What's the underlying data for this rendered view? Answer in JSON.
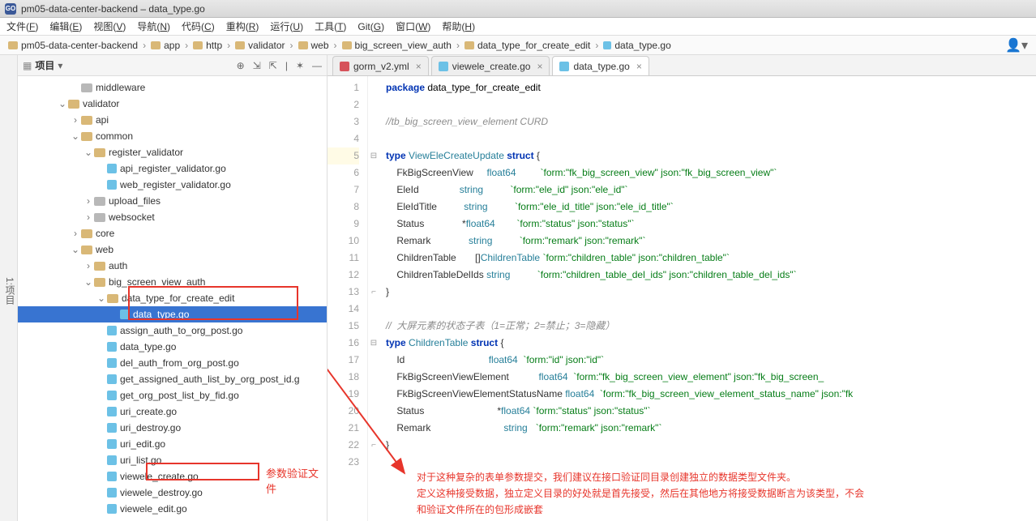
{
  "window": {
    "title": "pm05-data-center-backend – data_type.go",
    "app_icon": "GO"
  },
  "menubar": [
    {
      "l": "文件",
      "u": "F"
    },
    {
      "l": "编辑",
      "u": "E"
    },
    {
      "l": "视图",
      "u": "V"
    },
    {
      "l": "导航",
      "u": "N"
    },
    {
      "l": "代码",
      "u": "C"
    },
    {
      "l": "重构",
      "u": "R"
    },
    {
      "l": "运行",
      "u": "U"
    },
    {
      "l": "工具",
      "u": "T"
    },
    {
      "l": "Git",
      "u": "G"
    },
    {
      "l": "窗口",
      "u": "W"
    },
    {
      "l": "帮助",
      "u": "H"
    }
  ],
  "breadcrumbs": [
    "pm05-data-center-backend",
    "app",
    "http",
    "validator",
    "web",
    "big_screen_view_auth",
    "data_type_for_create_edit",
    "data_type.go"
  ],
  "sidebar": {
    "title": "项目",
    "left_gutter_label": "1:项目",
    "tree": [
      {
        "depth": 4,
        "tw": "",
        "icon": "dirgrey",
        "label": "middleware"
      },
      {
        "depth": 3,
        "tw": "v",
        "icon": "dir",
        "label": "validator"
      },
      {
        "depth": 4,
        "tw": ">",
        "icon": "dir",
        "label": "api"
      },
      {
        "depth": 4,
        "tw": "v",
        "icon": "dir",
        "label": "common"
      },
      {
        "depth": 5,
        "tw": "v",
        "icon": "dir",
        "label": "register_validator"
      },
      {
        "depth": 6,
        "tw": "",
        "icon": "go",
        "label": "api_register_validator.go"
      },
      {
        "depth": 6,
        "tw": "",
        "icon": "go",
        "label": "web_register_validator.go"
      },
      {
        "depth": 5,
        "tw": ">",
        "icon": "dirgrey",
        "label": "upload_files"
      },
      {
        "depth": 5,
        "tw": ">",
        "icon": "dirgrey",
        "label": "websocket"
      },
      {
        "depth": 4,
        "tw": ">",
        "icon": "dir",
        "label": "core"
      },
      {
        "depth": 4,
        "tw": "v",
        "icon": "dir",
        "label": "web"
      },
      {
        "depth": 5,
        "tw": ">",
        "icon": "dir",
        "label": "auth"
      },
      {
        "depth": 5,
        "tw": "v",
        "icon": "dir",
        "label": "big_screen_view_auth"
      },
      {
        "depth": 6,
        "tw": "v",
        "icon": "dir",
        "label": "data_type_for_create_edit"
      },
      {
        "depth": 7,
        "tw": "",
        "icon": "go",
        "label": "data_type.go",
        "selected": true
      },
      {
        "depth": 6,
        "tw": "",
        "icon": "go",
        "label": "assign_auth_to_org_post.go"
      },
      {
        "depth": 6,
        "tw": "",
        "icon": "go",
        "label": "data_type.go"
      },
      {
        "depth": 6,
        "tw": "",
        "icon": "go",
        "label": "del_auth_from_org_post.go"
      },
      {
        "depth": 6,
        "tw": "",
        "icon": "go",
        "label": "get_assigned_auth_list_by_org_post_id.g"
      },
      {
        "depth": 6,
        "tw": "",
        "icon": "go",
        "label": "get_org_post_list_by_fid.go"
      },
      {
        "depth": 6,
        "tw": "",
        "icon": "go",
        "label": "uri_create.go"
      },
      {
        "depth": 6,
        "tw": "",
        "icon": "go",
        "label": "uri_destroy.go"
      },
      {
        "depth": 6,
        "tw": "",
        "icon": "go",
        "label": "uri_edit.go"
      },
      {
        "depth": 6,
        "tw": "",
        "icon": "go",
        "label": "uri_list.go"
      },
      {
        "depth": 6,
        "tw": "",
        "icon": "go",
        "label": "viewele_create.go"
      },
      {
        "depth": 6,
        "tw": "",
        "icon": "go",
        "label": "viewele_destroy.go"
      },
      {
        "depth": 6,
        "tw": "",
        "icon": "go",
        "label": "viewele_edit.go"
      }
    ]
  },
  "tabs": [
    {
      "icon": "yml",
      "label": "gorm_v2.yml",
      "active": false
    },
    {
      "icon": "go",
      "label": "viewele_create.go",
      "active": false
    },
    {
      "icon": "go",
      "label": "data_type.go",
      "active": true
    }
  ],
  "code": {
    "lines": [
      {
        "n": 1,
        "html": "<span class='kw'>package</span> <span class='pkg'>data_type_for_create_edit</span>"
      },
      {
        "n": 2,
        "html": ""
      },
      {
        "n": 3,
        "html": "<span class='cmt'>//tb_big_screen_view_element CURD</span>"
      },
      {
        "n": 4,
        "html": ""
      },
      {
        "n": 5,
        "html": "<span class='kw'>type</span> <span class='typ'>ViewEleCreateUpdate</span> <span class='kw'>struct</span> {",
        "fold": "-",
        "hl": true
      },
      {
        "n": 6,
        "html": "    FkBigScreenView     <span class='typ'>float64</span>         <span class='str'>`form:\"fk_big_screen_view\" json:\"fk_big_screen_view\"`</span>"
      },
      {
        "n": 7,
        "html": "    EleId               <span class='typ'>string</span>          <span class='str'>`form:\"ele_id\" json:\"ele_id\"`</span>"
      },
      {
        "n": 8,
        "html": "    EleIdTitle          <span class='typ'>string</span>          <span class='str'>`form:\"ele_id_title\" json:\"ele_id_title\"`</span>"
      },
      {
        "n": 9,
        "html": "    Status              *<span class='typ'>float64</span>        <span class='str'>`form:\"status\" json:\"status\"`</span>"
      },
      {
        "n": 10,
        "html": "    Remark              <span class='typ'>string</span>          <span class='str'>`form:\"remark\" json:\"remark\"`</span>"
      },
      {
        "n": 11,
        "html": "    ChildrenTable       []<span class='typ'>ChildrenTable</span> <span class='str'>`form:\"children_table\" json:\"children_table\"`</span>"
      },
      {
        "n": 12,
        "html": "    ChildrenTableDelIds <span class='typ'>string</span>          <span class='str'>`form:\"children_table_del_ids\" json:\"children_table_del_ids\"`</span>"
      },
      {
        "n": 13,
        "html": "}",
        "fold": "}"
      },
      {
        "n": 14,
        "html": ""
      },
      {
        "n": 15,
        "html": "<span class='cmt'>//  大屏元素的状态子表（1=正常；2=禁止；3=隐藏）</span>"
      },
      {
        "n": 16,
        "html": "<span class='kw'>type</span> <span class='typ'>ChildrenTable</span> <span class='kw'>struct</span> {",
        "fold": "-"
      },
      {
        "n": 17,
        "html": "    Id                               <span class='typ'>float64</span>  <span class='str'>`form:\"id\" json:\"id\"`</span>"
      },
      {
        "n": 18,
        "html": "    FkBigScreenViewElement           <span class='typ'>float64</span>  <span class='str'>`form:\"fk_big_screen_view_element\" json:\"fk_big_screen_</span>"
      },
      {
        "n": 19,
        "html": "    FkBigScreenViewElementStatusName <span class='typ'>float64</span>  <span class='str'>`form:\"fk_big_screen_view_element_status_name\" json:\"fk</span>"
      },
      {
        "n": 20,
        "html": "    Status                           *<span class='typ'>float64</span> <span class='str'>`form:\"status\" json:\"status\"`</span>"
      },
      {
        "n": 21,
        "html": "    Remark                           <span class='typ'>string</span>   <span class='str'>`form:\"remark\" json:\"remark\"`</span>"
      },
      {
        "n": 22,
        "html": "}",
        "fold": "}"
      },
      {
        "n": 23,
        "html": ""
      }
    ]
  },
  "annotations": {
    "param_label": "参数验证文件",
    "note1": "对于这种复杂的表单参数提交，我们建议在接口验证同目录创建独立的数据类型文件夹。",
    "note2": "定义这种接受数据，独立定义目录的好处就是首先接受，然后在其他地方将接受数据断言为该类型，不会",
    "note3": "和验证文件所在的包形成嵌套"
  }
}
